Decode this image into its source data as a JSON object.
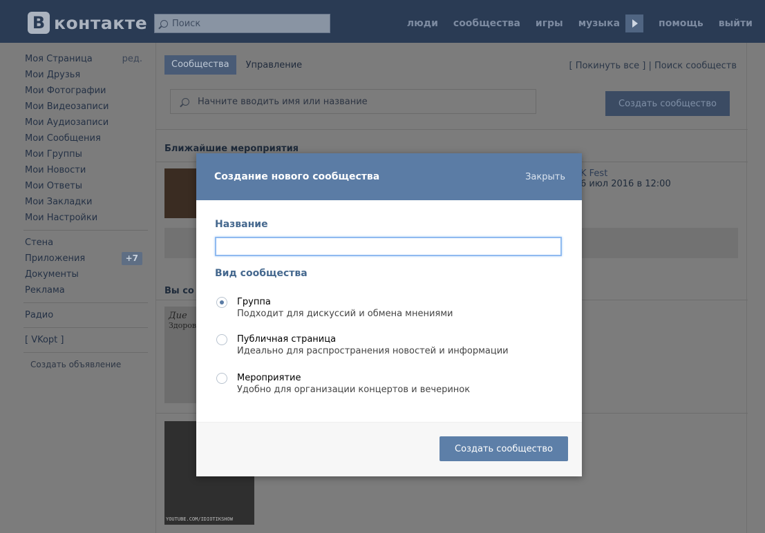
{
  "header": {
    "logo_letter": "В",
    "logo_text": "контакте",
    "search_placeholder": "Поиск",
    "nav": [
      "люди",
      "сообщества",
      "игры",
      "музыка",
      "помощь",
      "выйти"
    ]
  },
  "sidebar": {
    "edit_label": "ред.",
    "group1": [
      "Моя Страница",
      "Мои Друзья",
      "Мои Фотографии",
      "Мои Видеозаписи",
      "Мои Аудиозаписи",
      "Мои Сообщения",
      "Мои Группы",
      "Мои Новости",
      "Мои Ответы",
      "Мои Закладки",
      "Мои Настройки"
    ],
    "group2": [
      "Стена",
      "Приложения",
      "Документы",
      "Реклама"
    ],
    "apps_badge": "+7",
    "radio": "Радио",
    "vkopt": "[ VKopt ]",
    "ad": "Создать объявление"
  },
  "main": {
    "tab_active": "Сообщества",
    "tab_other": "Управление",
    "leave_all": "[ Покинуть все ]",
    "separator": "|",
    "search_communities": "Поиск сообществ",
    "search_placeholder": "Начните вводить имя или название",
    "create_button": "Создать сообщество",
    "events_title": "Ближайшие мероприятия",
    "event_name": "K Fest",
    "event_date": "6 июл 2016 в 12:00",
    "your_groups": "Вы со",
    "diet_text": "Дие",
    "diet_sub": "Здоровы",
    "thumb_caption": "YOUTUBE.COM/IDIOTIKSHOW"
  },
  "modal": {
    "title": "Создание нового сообщества",
    "close": "Закрыть",
    "name_label": "Название",
    "name_value": "",
    "type_label": "Вид сообщества",
    "options": [
      {
        "title": "Группа",
        "desc": "Подходит для дискуссий и обмена мнениями",
        "checked": true
      },
      {
        "title": "Публичная страница",
        "desc": "Идеально для распространения новостей и информации",
        "checked": false
      },
      {
        "title": "Мероприятие",
        "desc": "Удобно для организации концертов и вечеринок",
        "checked": false
      }
    ],
    "submit": "Создать сообщество"
  },
  "colors": {
    "header_bg": "#2a3b54",
    "modal_header": "#5b7ca5",
    "label_blue": "#45688e",
    "overlay_gray": "#7c7c7c"
  }
}
